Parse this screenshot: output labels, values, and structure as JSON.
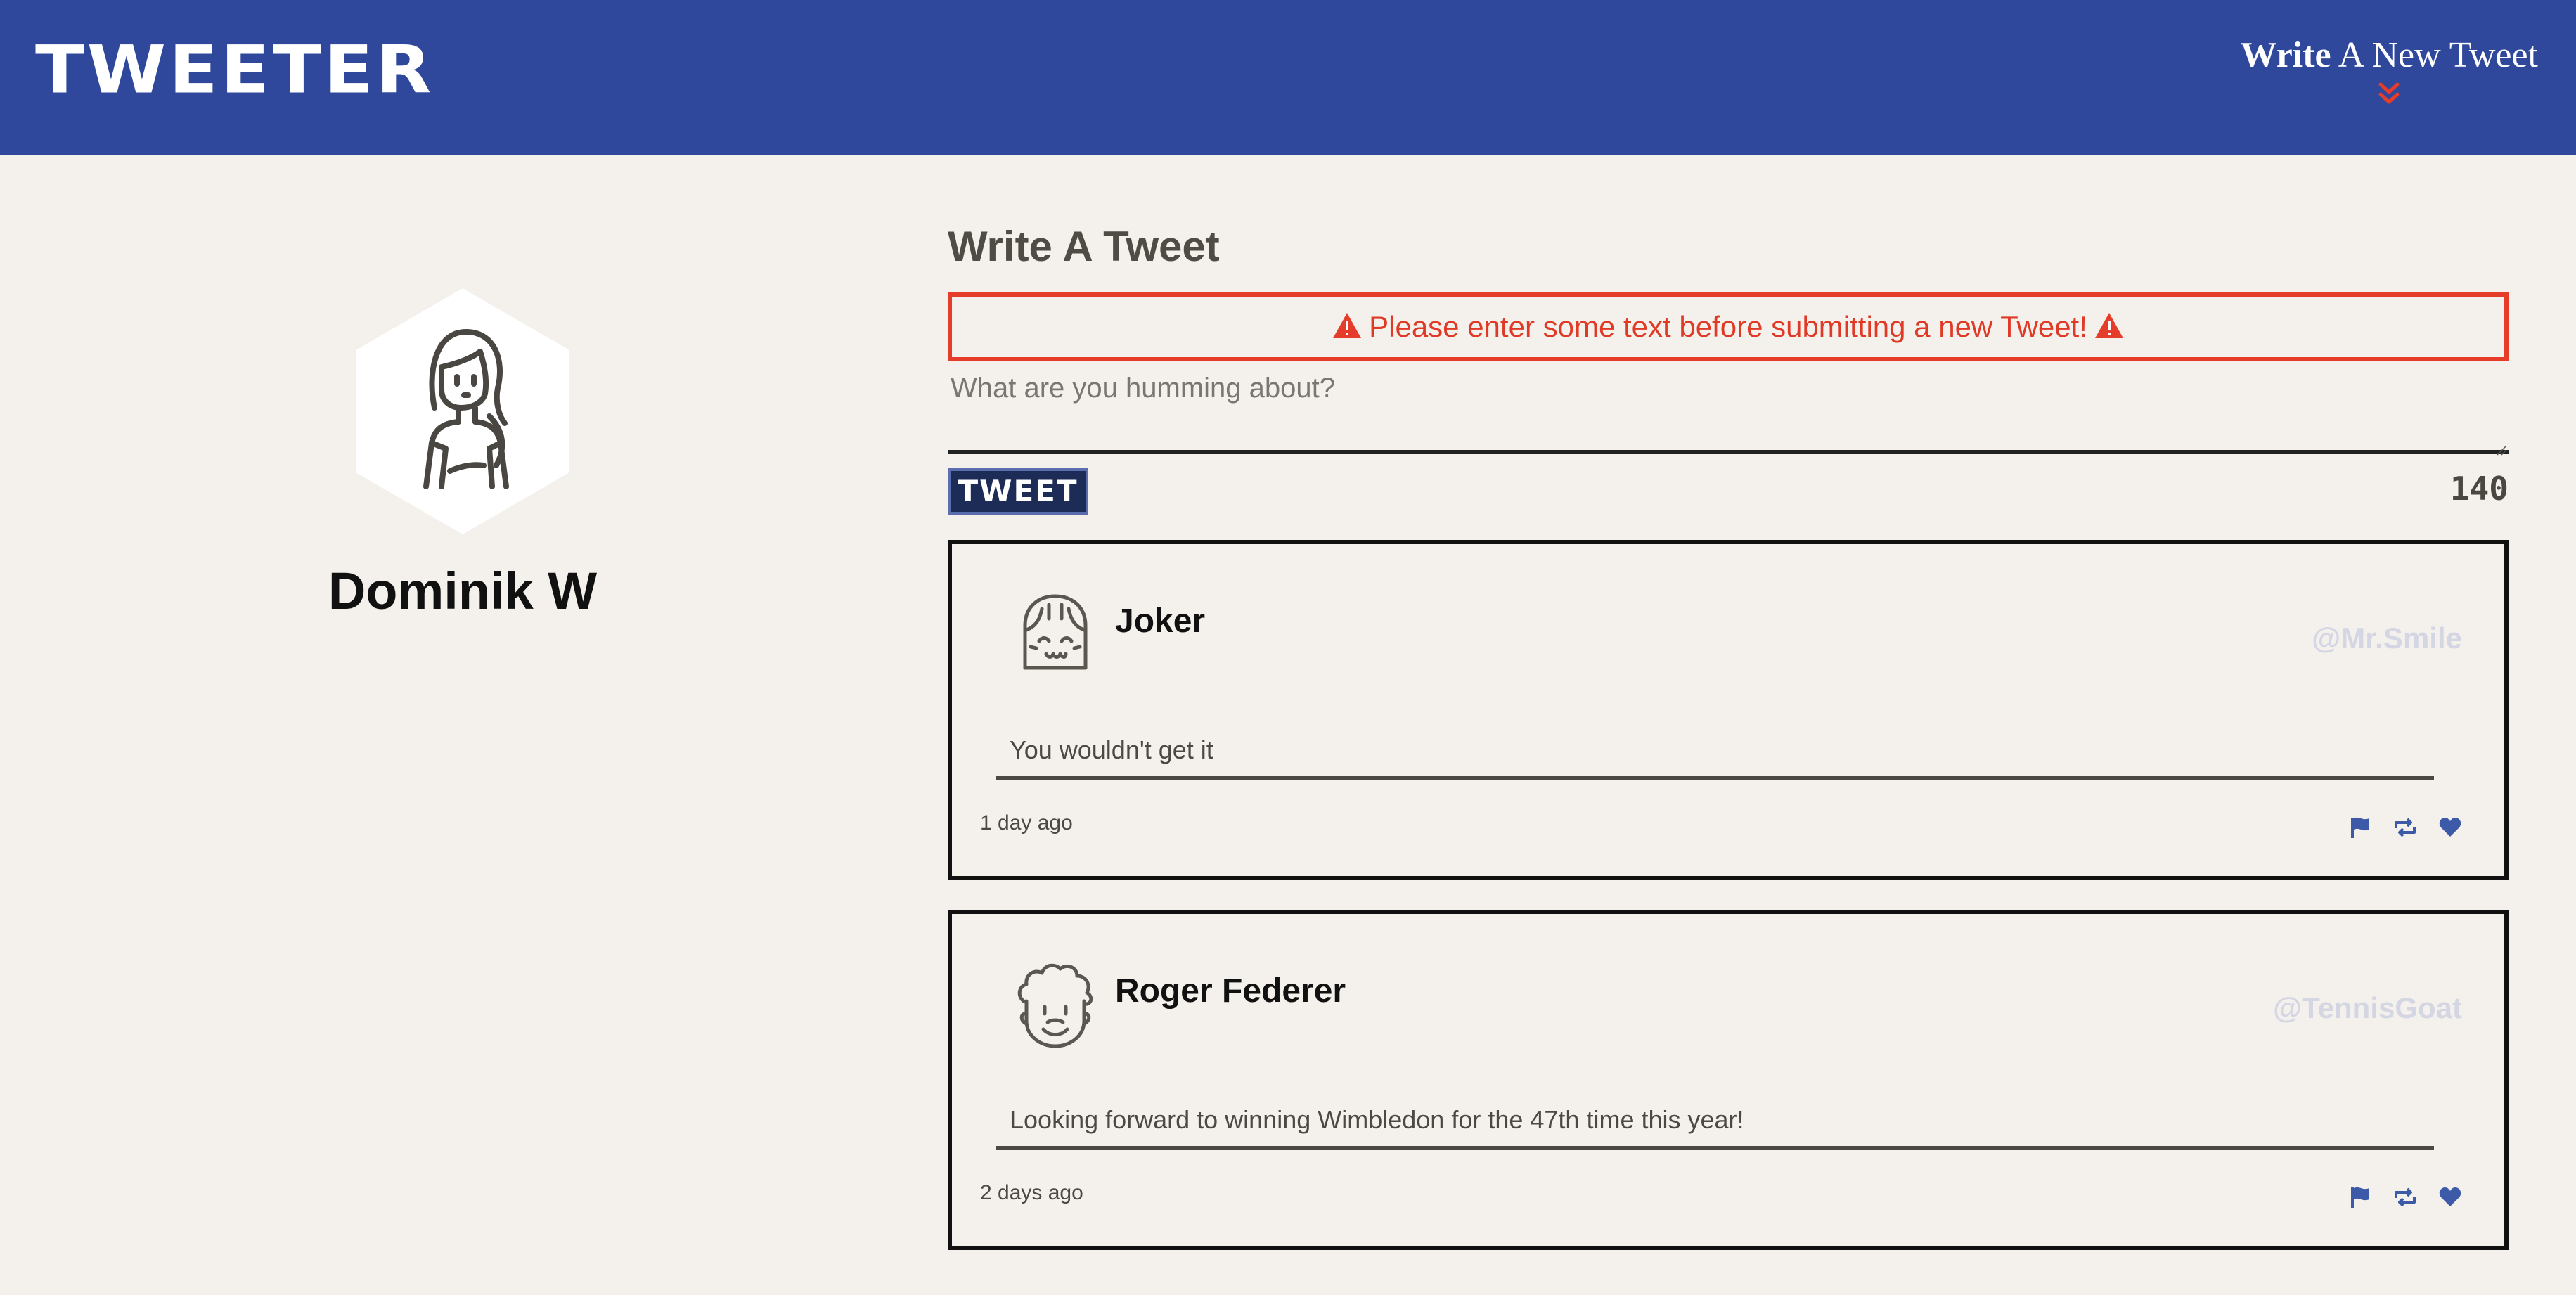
{
  "nav": {
    "logo": "TWEETER",
    "write_bold": "Write",
    "write_rest": " A New Tweet"
  },
  "profile": {
    "name": "Dominik W"
  },
  "compose": {
    "title": "Write A Tweet",
    "error": "Please enter some text before submitting a new Tweet!",
    "placeholder": "What are you humming about?",
    "button_label": "TWEET",
    "counter": "140"
  },
  "tweets": [
    {
      "name": "Joker",
      "handle": "@Mr.Smile",
      "content": "You wouldn't get it",
      "time": "1 day ago"
    },
    {
      "name": "Roger Federer",
      "handle": "@TennisGoat",
      "content": "Looking forward to winning Wimbledon for the 47th time this year!",
      "time": "2 days ago"
    }
  ],
  "icons": {
    "nav_toggle": "double-chevron-down-icon",
    "warning": "warning-triangle-icon",
    "flag": "flag-icon",
    "retweet": "retweet-icon",
    "like": "heart-icon"
  },
  "colors": {
    "nav_bg": "#2f489c",
    "page_bg": "#f4f1ec",
    "error": "#e53d2a",
    "button_bg": "#1d2b57",
    "handle": "#d4d6e4",
    "action_icon": "#3d5aa8"
  }
}
